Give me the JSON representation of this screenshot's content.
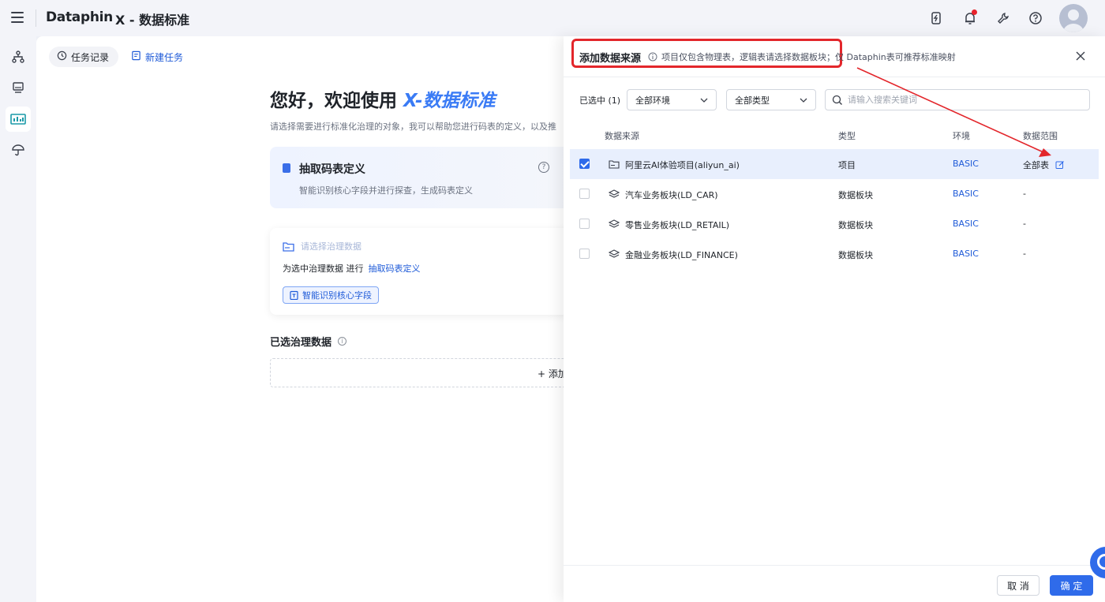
{
  "header": {
    "logo": "Dataphin",
    "app_title": "X - 数据标准"
  },
  "main": {
    "task_history": "任务记录",
    "new_task": "新建任务",
    "welcome_prefix": "您好，欢迎使用",
    "welcome_accent": "X-数据标准",
    "subtitle": "请选择需要进行标准化治理的对象，我可以帮助您进行码表的定义，以及推",
    "card1": {
      "title": "抽取码表定义",
      "desc": "智能识别核心字段并进行探查，生成码表定义",
      "help": "?"
    },
    "card2": {
      "placeholder": "请选择治理数据",
      "line_prefix": "为选中治理数据 进行",
      "line_link": "抽取码表定义",
      "tag": "智能识别核心字段"
    },
    "selected_title": "已选治理数据",
    "info_glyph": "i",
    "add_label": "+ 添加"
  },
  "drawer": {
    "title": "添加数据来源",
    "note": "项目仅包含物理表，逻辑表请选择数据板块；仅 Dataphin表可推荐标准映射",
    "selected_count": "已选中 (1)",
    "env_filter": "全部环境",
    "type_filter": "全部类型",
    "search_placeholder": "请输入搜索关键词",
    "columns": [
      "数据来源",
      "类型",
      "环境",
      "数据范围"
    ],
    "rows": [
      {
        "name": "阿里云AI体验项目(aliyun_ai)",
        "type": "项目",
        "env": "BASIC",
        "scope": "全部表",
        "checked": true
      },
      {
        "name": "汽车业务板块(LD_CAR)",
        "type": "数据板块",
        "env": "BASIC",
        "scope": "-",
        "checked": false
      },
      {
        "name": "零售业务板块(LD_RETAIL)",
        "type": "数据板块",
        "env": "BASIC",
        "scope": "-",
        "checked": false
      },
      {
        "name": "金融业务板块(LD_FINANCE)",
        "type": "数据板块",
        "env": "BASIC",
        "scope": "-",
        "checked": false
      }
    ],
    "cancel": "取 消",
    "confirm": "确 定"
  },
  "colors": {
    "accent": "#2f6bea",
    "annotation": "#e3262b",
    "selected_row": "#e8effd"
  }
}
